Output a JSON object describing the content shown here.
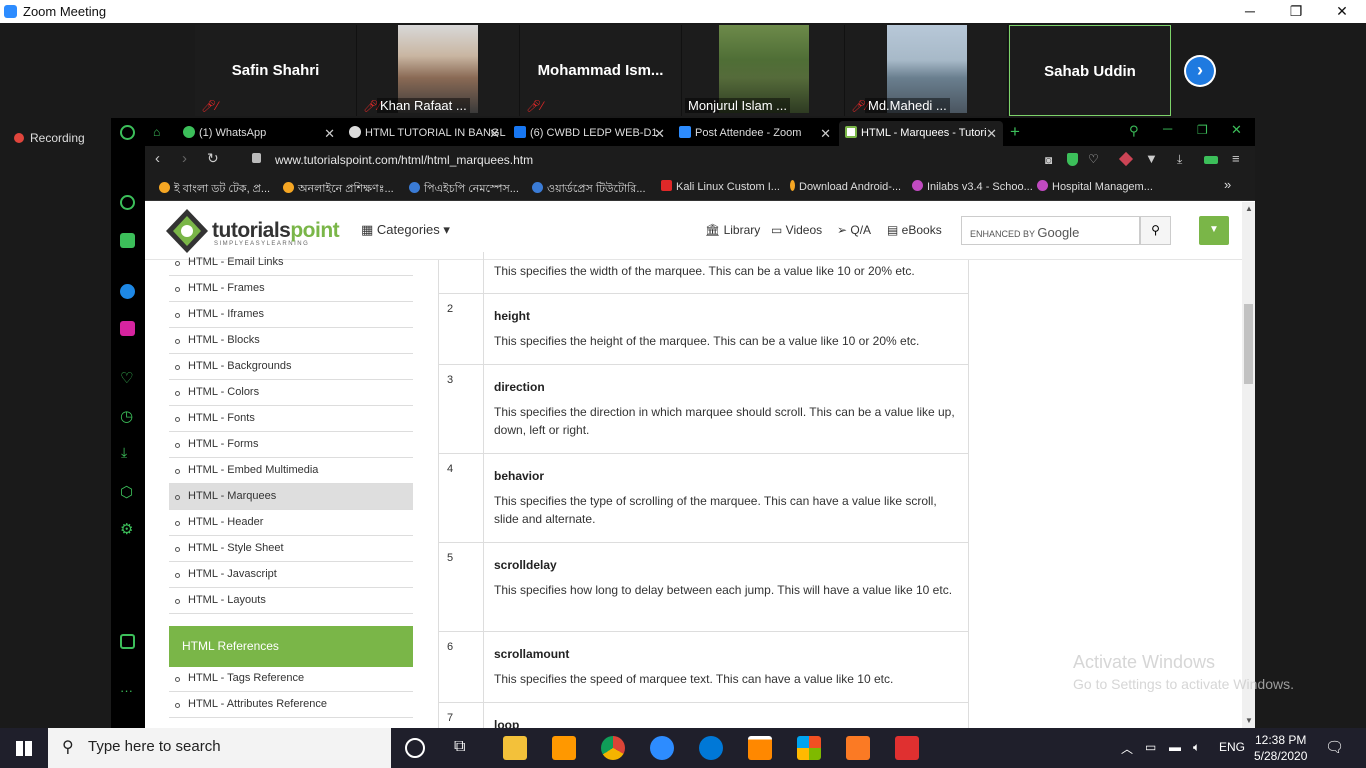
{
  "zoom": {
    "window_title": "Zoom Meeting",
    "recording_label": "Recording",
    "participants": [
      {
        "name": "Safin Shahri"
      },
      {
        "name": "Khan Rafaat ..."
      },
      {
        "name": "Mohammad  Ism..."
      },
      {
        "name": "Monjurul Islam ..."
      },
      {
        "name": "Md.Mahedi ..."
      },
      {
        "name": "Sahab Uddin"
      }
    ]
  },
  "browser": {
    "tabs": [
      {
        "label": "(1) WhatsApp"
      },
      {
        "label": "HTML TUTORIAL IN BANGL"
      },
      {
        "label": "(6) CWBD LEDP WEB-D1"
      },
      {
        "label": "Post Attendee - Zoom"
      },
      {
        "label": "HTML - Marquees - Tutori"
      }
    ],
    "url": "www.tutorialspoint.com/html/html_marquees.htm",
    "bookmarks": [
      "ই বাংলা ডট টেক, প্র...",
      "অনলাইনে প্রশিক্ষণঃ...",
      "পিএইচপি নেমস্পেস...",
      "ওয়ার্ডপ্রেস টিউটোরি...",
      "Kali Linux Custom I...",
      "Download Android-...",
      "Inilabs v3.4 - Schoo...",
      "Hospital Managem..."
    ]
  },
  "site": {
    "logo_main": "tutorials",
    "logo_accent": "point",
    "logo_tagline": "SIMPLYEASYLEARNING",
    "categories_label": "Categories",
    "nav": {
      "library": "Library",
      "videos": "Videos",
      "qa": "Q/A",
      "ebooks": "eBooks"
    },
    "search_prefix": "ENHANCED BY",
    "search_brand": "Google"
  },
  "left_nav": {
    "items": [
      "HTML - Email Links",
      "HTML - Frames",
      "HTML - Iframes",
      "HTML - Blocks",
      "HTML - Backgrounds",
      "HTML - Colors",
      "HTML - Fonts",
      "HTML - Forms",
      "HTML - Embed Multimedia",
      "HTML - Marquees",
      "HTML - Header",
      "HTML - Style Sheet",
      "HTML - Javascript",
      "HTML - Layouts"
    ],
    "active_item": "HTML - Marquees",
    "references_header": "HTML References",
    "references": [
      "HTML - Tags Reference",
      "HTML - Attributes Reference"
    ]
  },
  "attributes": {
    "rows": [
      {
        "num": "",
        "name": "",
        "desc": "This specifies the width of the marquee. This can be a value like 10 or 20% etc."
      },
      {
        "num": "2",
        "name": "height",
        "desc": "This specifies the height of the marquee. This can be a value like 10 or 20% etc."
      },
      {
        "num": "3",
        "name": "direction",
        "desc": "This specifies the direction in which marquee should scroll. This can be a value like up, down, left or right."
      },
      {
        "num": "4",
        "name": "behavior",
        "desc": "This specifies the type of scrolling of the marquee. This can have a value like scroll, slide and alternate."
      },
      {
        "num": "5",
        "name": "scrolldelay",
        "desc": "This specifies how long to delay between each jump. This will have a value like 10 etc."
      },
      {
        "num": "6",
        "name": "scrollamount",
        "desc": "This specifies the speed of marquee text. This can have a value like 10 etc."
      },
      {
        "num": "7",
        "name": "loop",
        "desc": ""
      }
    ]
  },
  "windows_watermark": {
    "line1": "Activate Windows",
    "line2": "Go to Settings to activate Windows."
  },
  "taskbar": {
    "search_placeholder": "Type here to search",
    "language": "ENG",
    "time": "12:38 PM",
    "date": "5/28/2020"
  }
}
